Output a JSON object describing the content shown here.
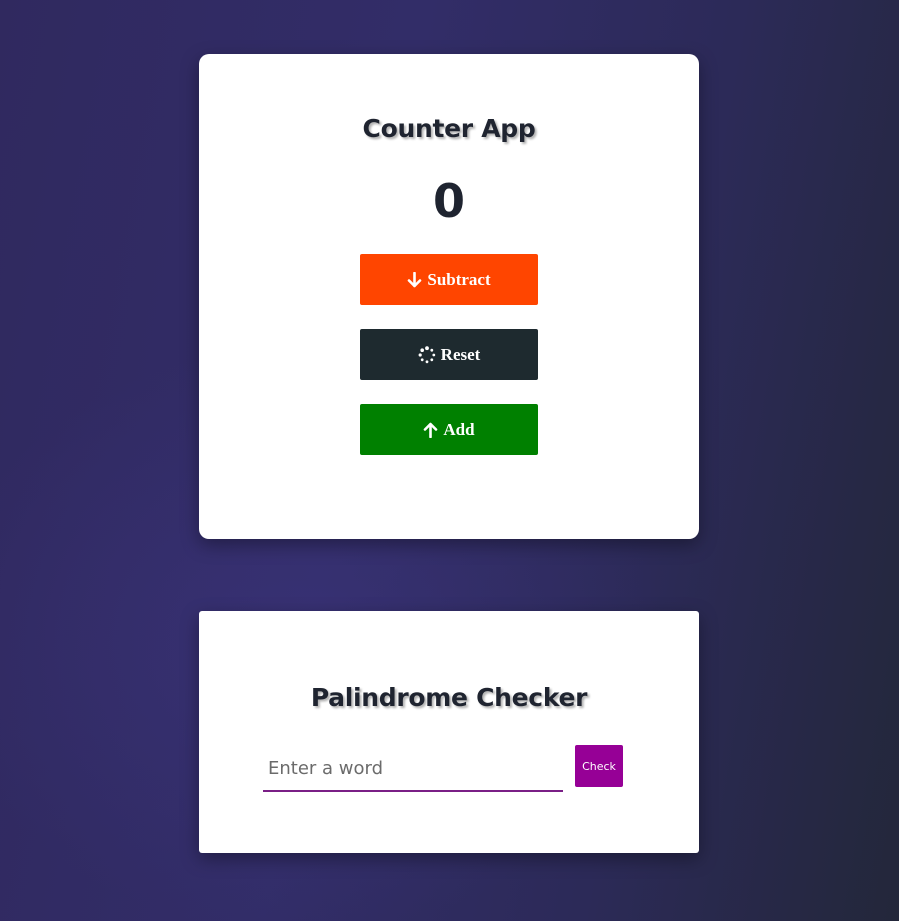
{
  "counter": {
    "title": "Counter App",
    "value": "0",
    "subtract_label": "Subtract",
    "reset_label": "Reset",
    "add_label": "Add",
    "subtract_color": "#ff4500",
    "reset_color": "#1e2a2f",
    "add_color": "#008000"
  },
  "palindrome": {
    "title": "Palindrome Checker",
    "input_value": "",
    "input_placeholder": "Enter a word",
    "check_label": "Check",
    "check_color": "#960096"
  },
  "icons": {
    "subtract": "arrow-down-icon",
    "reset": "spinner-icon",
    "add": "arrow-up-icon"
  }
}
